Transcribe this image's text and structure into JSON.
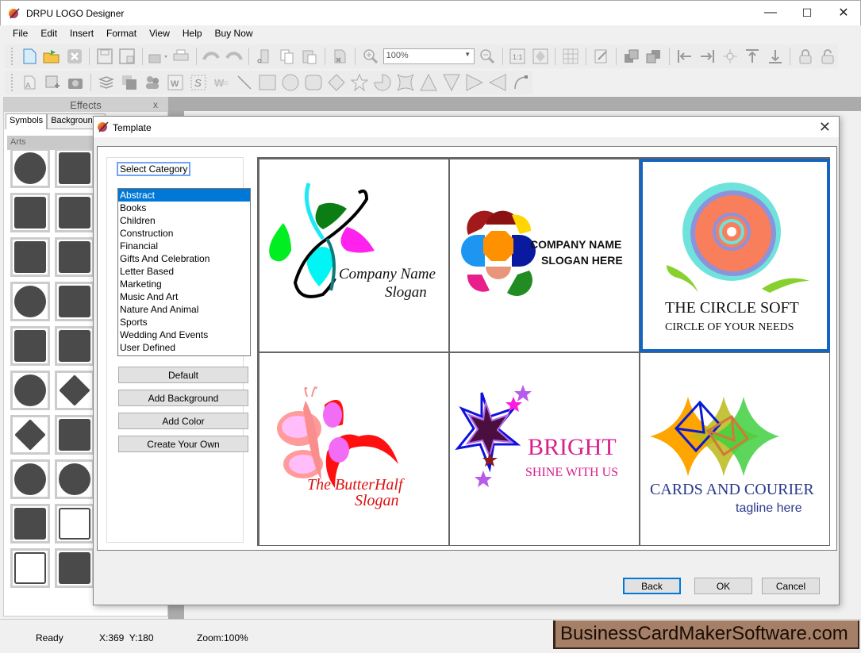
{
  "window": {
    "title": "DRPU LOGO Designer",
    "minimize": "—",
    "maximize": "☐",
    "close": "✕"
  },
  "menu": [
    "File",
    "Edit",
    "Insert",
    "Format",
    "View",
    "Help",
    "Buy Now"
  ],
  "toolbar": {
    "zoom_value": "100%"
  },
  "effects": {
    "title": "Effects",
    "close": "x",
    "tabs": [
      "Symbols",
      "Backgrounds"
    ],
    "section": "Arts"
  },
  "dialog": {
    "title": "Template",
    "close": "✕",
    "category_label": "Select Category",
    "categories": [
      "Abstract",
      "Books",
      "Children",
      "Construction",
      "Financial",
      "Gifts And Celebration",
      "Letter Based",
      "Marketing",
      "Music And Art",
      "Nature And Animal",
      "Sports",
      "Wedding And Events",
      "User Defined"
    ],
    "selected_category": "Abstract",
    "buttons": {
      "default": "Default",
      "add_background": "Add Background",
      "add_color": "Add Color",
      "create_own": "Create Your Own"
    },
    "templates": [
      {
        "line1": "Company Name",
        "line2": "Slogan"
      },
      {
        "line1": "COMPANY NAME",
        "line2": "SLOGAN HERE"
      },
      {
        "line1": "THE CIRCLE SOFT",
        "line2": "CIRCLE OF YOUR NEEDS",
        "selected": true
      },
      {
        "line1": "The ButterHalf",
        "line2": "Slogan"
      },
      {
        "line1": "BRIGHT",
        "line2": "SHINE WITH US"
      },
      {
        "line1": "CARDS AND COURIER",
        "line2": "tagline here"
      }
    ],
    "footer": {
      "back": "Back",
      "ok": "OK",
      "cancel": "Cancel"
    }
  },
  "status": {
    "state": "Ready",
    "coords": "X:369  Y:180",
    "zoom": "Zoom:100%"
  },
  "brand": "BusinessCardMakerSoftware.com"
}
